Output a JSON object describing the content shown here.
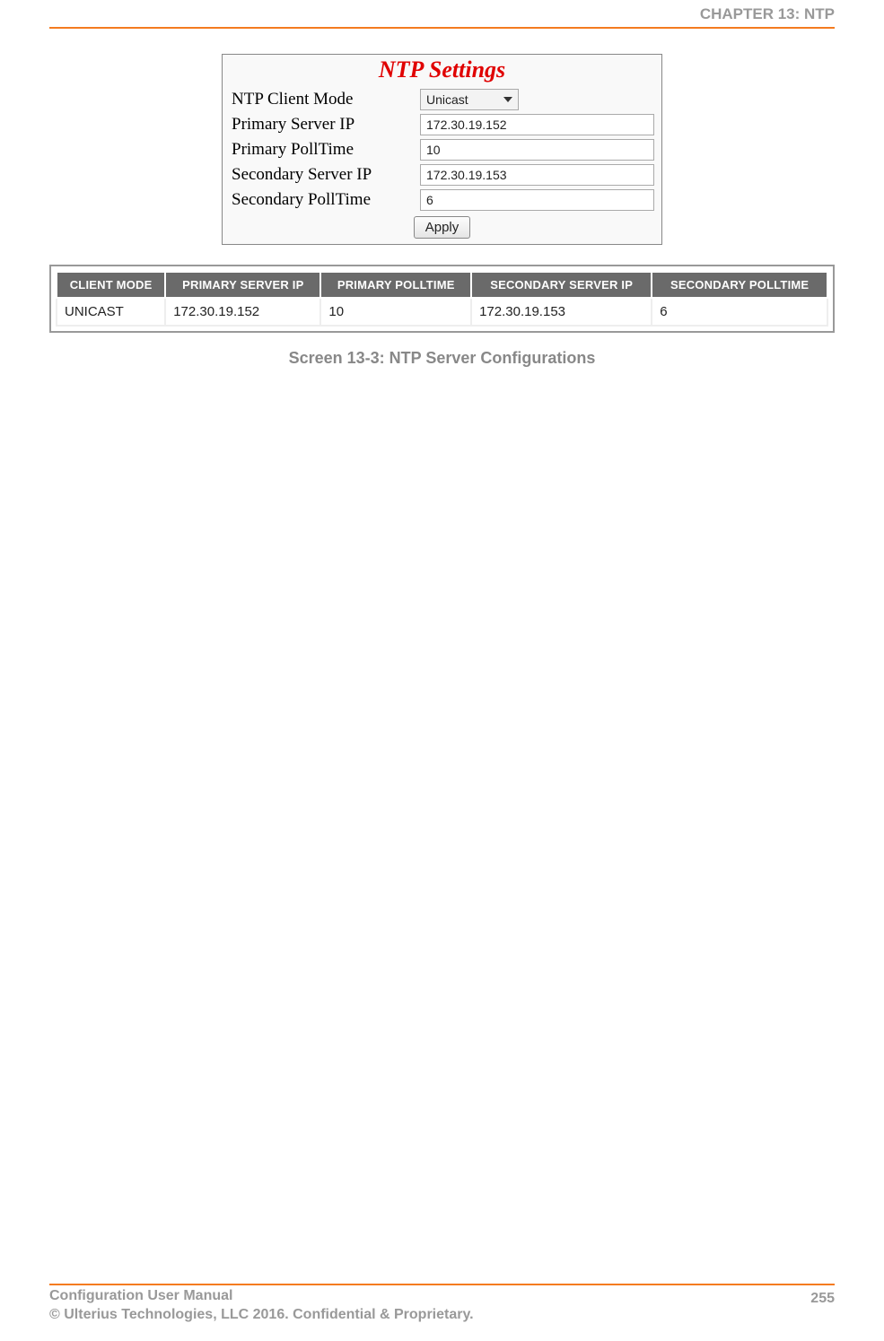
{
  "header": {
    "chapter": "CHAPTER 13: NTP"
  },
  "form": {
    "title": "NTP Settings",
    "rows": {
      "client_mode": {
        "label": "NTP Client Mode",
        "value": "Unicast"
      },
      "primary_ip": {
        "label": "Primary Server IP",
        "value": "172.30.19.152"
      },
      "primary_poll": {
        "label": "Primary PollTime",
        "value": "10"
      },
      "secondary_ip": {
        "label": "Secondary Server IP",
        "value": "172.30.19.153"
      },
      "secondary_poll": {
        "label": "Secondary PollTime",
        "value": "6"
      }
    },
    "apply_label": "Apply"
  },
  "table": {
    "headers": [
      "CLIENT MODE",
      "PRIMARY SERVER IP",
      "PRIMARY POLLTIME",
      "SECONDARY SERVER IP",
      "SECONDARY POLLTIME"
    ],
    "row": [
      "UNICAST",
      "172.30.19.152",
      "10",
      "172.30.19.153",
      "6"
    ]
  },
  "caption": "Screen 13-3: NTP Server Configurations",
  "footer": {
    "left_line1": "Configuration User Manual",
    "left_line2": "© Ulterius Technologies, LLC 2016. Confidential & Proprietary.",
    "page": "255"
  }
}
